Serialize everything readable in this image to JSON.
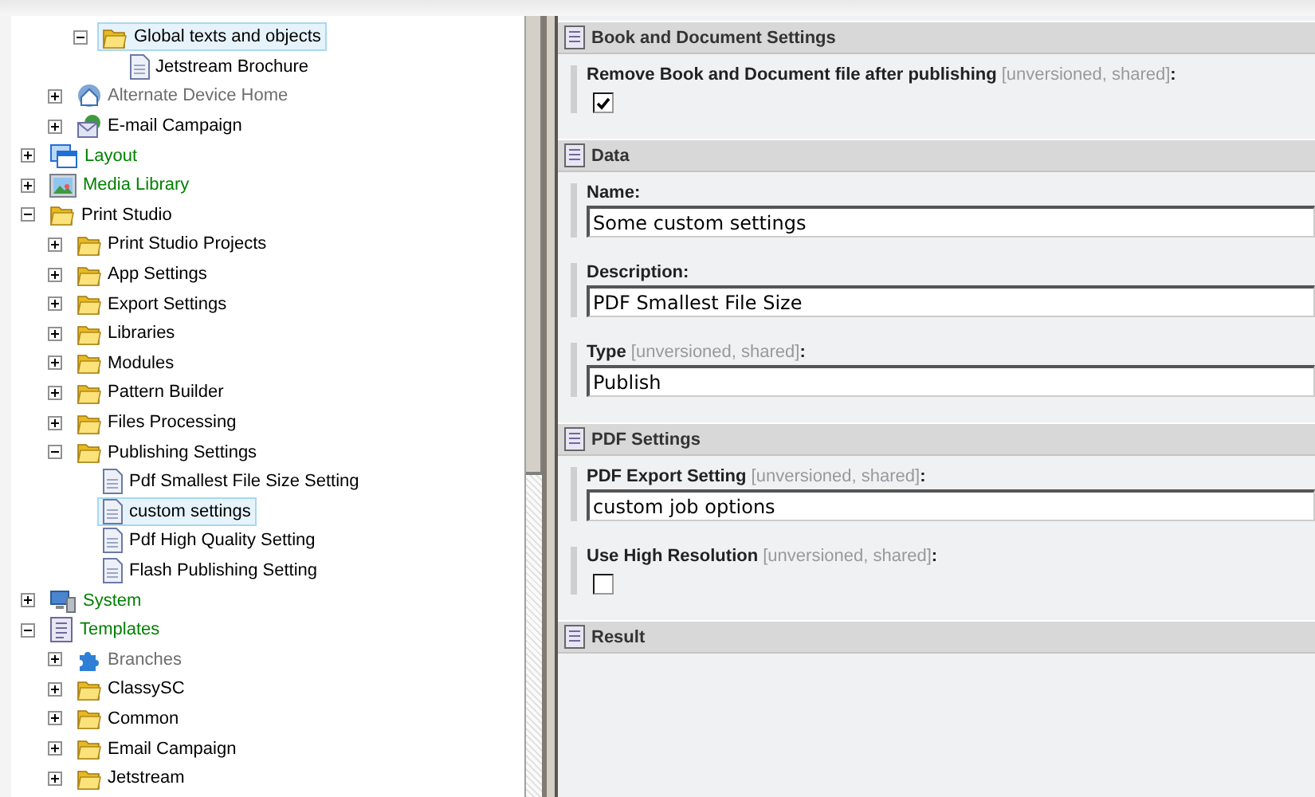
{
  "tree": {
    "nodes": [
      {
        "children": [
          {
            "children": [
              {
                "label": "Global texts and objects",
                "kind": "folder",
                "expanded": true,
                "selected": true,
                "color": "#000000",
                "children": [
                  {
                    "label": "Jetstream Brochure",
                    "kind": "document",
                    "selected": false,
                    "color": "#000000"
                  }
                ]
              }
            ]
          },
          {
            "label": "Alternate Device Home",
            "kind": "home",
            "expanded": false,
            "selected": false,
            "color": "#6d6d6d"
          },
          {
            "label": "E-mail Campaign",
            "kind": "mail",
            "expanded": false,
            "selected": false,
            "color": "#000000"
          }
        ]
      },
      {
        "label": "Layout",
        "kind": "layout",
        "expanded": false,
        "selected": false,
        "color": "#008000"
      },
      {
        "label": "Media Library",
        "kind": "media",
        "expanded": false,
        "selected": false,
        "color": "#008000"
      },
      {
        "label": "Print Studio",
        "kind": "folder",
        "expanded": true,
        "selected": false,
        "color": "#000000",
        "children": [
          {
            "label": "Print Studio Projects",
            "kind": "folder",
            "expanded": false,
            "selected": false,
            "color": "#000000"
          },
          {
            "label": "App Settings",
            "kind": "folder",
            "expanded": false,
            "selected": false,
            "color": "#000000"
          },
          {
            "label": "Export Settings",
            "kind": "folder",
            "expanded": false,
            "selected": false,
            "color": "#000000"
          },
          {
            "label": "Libraries",
            "kind": "folder",
            "expanded": false,
            "selected": false,
            "color": "#000000"
          },
          {
            "label": "Modules",
            "kind": "folder",
            "expanded": false,
            "selected": false,
            "color": "#000000"
          },
          {
            "label": "Pattern Builder",
            "kind": "folder",
            "expanded": false,
            "selected": false,
            "color": "#000000"
          },
          {
            "label": "Files Processing",
            "kind": "folder",
            "expanded": false,
            "selected": false,
            "color": "#000000"
          },
          {
            "label": "Publishing Settings",
            "kind": "folder",
            "expanded": true,
            "selected": false,
            "color": "#000000",
            "children": [
              {
                "label": "Pdf Smallest File Size Setting",
                "kind": "document",
                "selected": false,
                "color": "#000000"
              },
              {
                "label": "custom settings",
                "kind": "document",
                "selected": true,
                "color": "#000000"
              },
              {
                "label": "Pdf High Quality Setting",
                "kind": "document",
                "selected": false,
                "color": "#000000"
              },
              {
                "label": "Flash Publishing Setting",
                "kind": "document",
                "selected": false,
                "color": "#000000"
              }
            ]
          }
        ]
      },
      {
        "label": "System",
        "kind": "system",
        "expanded": false,
        "selected": false,
        "color": "#008000"
      },
      {
        "label": "Templates",
        "kind": "templates",
        "expanded": true,
        "selected": false,
        "color": "#008000",
        "children": [
          {
            "label": "Branches",
            "kind": "branches",
            "expanded": false,
            "selected": false,
            "color": "#6d6d6d"
          },
          {
            "label": "ClassySC",
            "kind": "folder",
            "expanded": false,
            "selected": false,
            "color": "#000000"
          },
          {
            "label": "Common",
            "kind": "folder",
            "expanded": false,
            "selected": false,
            "color": "#000000"
          },
          {
            "label": "Email Campaign",
            "kind": "folder",
            "expanded": false,
            "selected": false,
            "color": "#000000"
          },
          {
            "label": "Jetstream",
            "kind": "folder",
            "expanded": false,
            "selected": false,
            "color": "#000000"
          }
        ]
      }
    ]
  },
  "sections": [
    {
      "title": "Book and Document Settings",
      "fields": [
        {
          "kind": "checkbox",
          "label": "Remove Book and Document file after publishing",
          "note": "[unversioned, shared]",
          "suffix": ":",
          "checked": true
        }
      ]
    },
    {
      "title": "Data",
      "fields": [
        {
          "kind": "text",
          "label": "Name:",
          "value": "Some custom settings"
        },
        {
          "kind": "text",
          "label": "Description:",
          "value": "PDF Smallest File Size"
        },
        {
          "kind": "text",
          "label": "Type",
          "note": "[unversioned, shared]",
          "suffix": ":",
          "value": "Publish"
        }
      ]
    },
    {
      "title": "PDF Settings",
      "fields": [
        {
          "kind": "text",
          "label": "PDF Export Setting",
          "note": "[unversioned, shared]",
          "suffix": ":",
          "value": "custom job options"
        },
        {
          "kind": "checkbox",
          "label": "Use High Resolution",
          "note": "[unversioned, shared]",
          "suffix": ":",
          "checked": false
        }
      ]
    },
    {
      "title": "Result"
    }
  ]
}
